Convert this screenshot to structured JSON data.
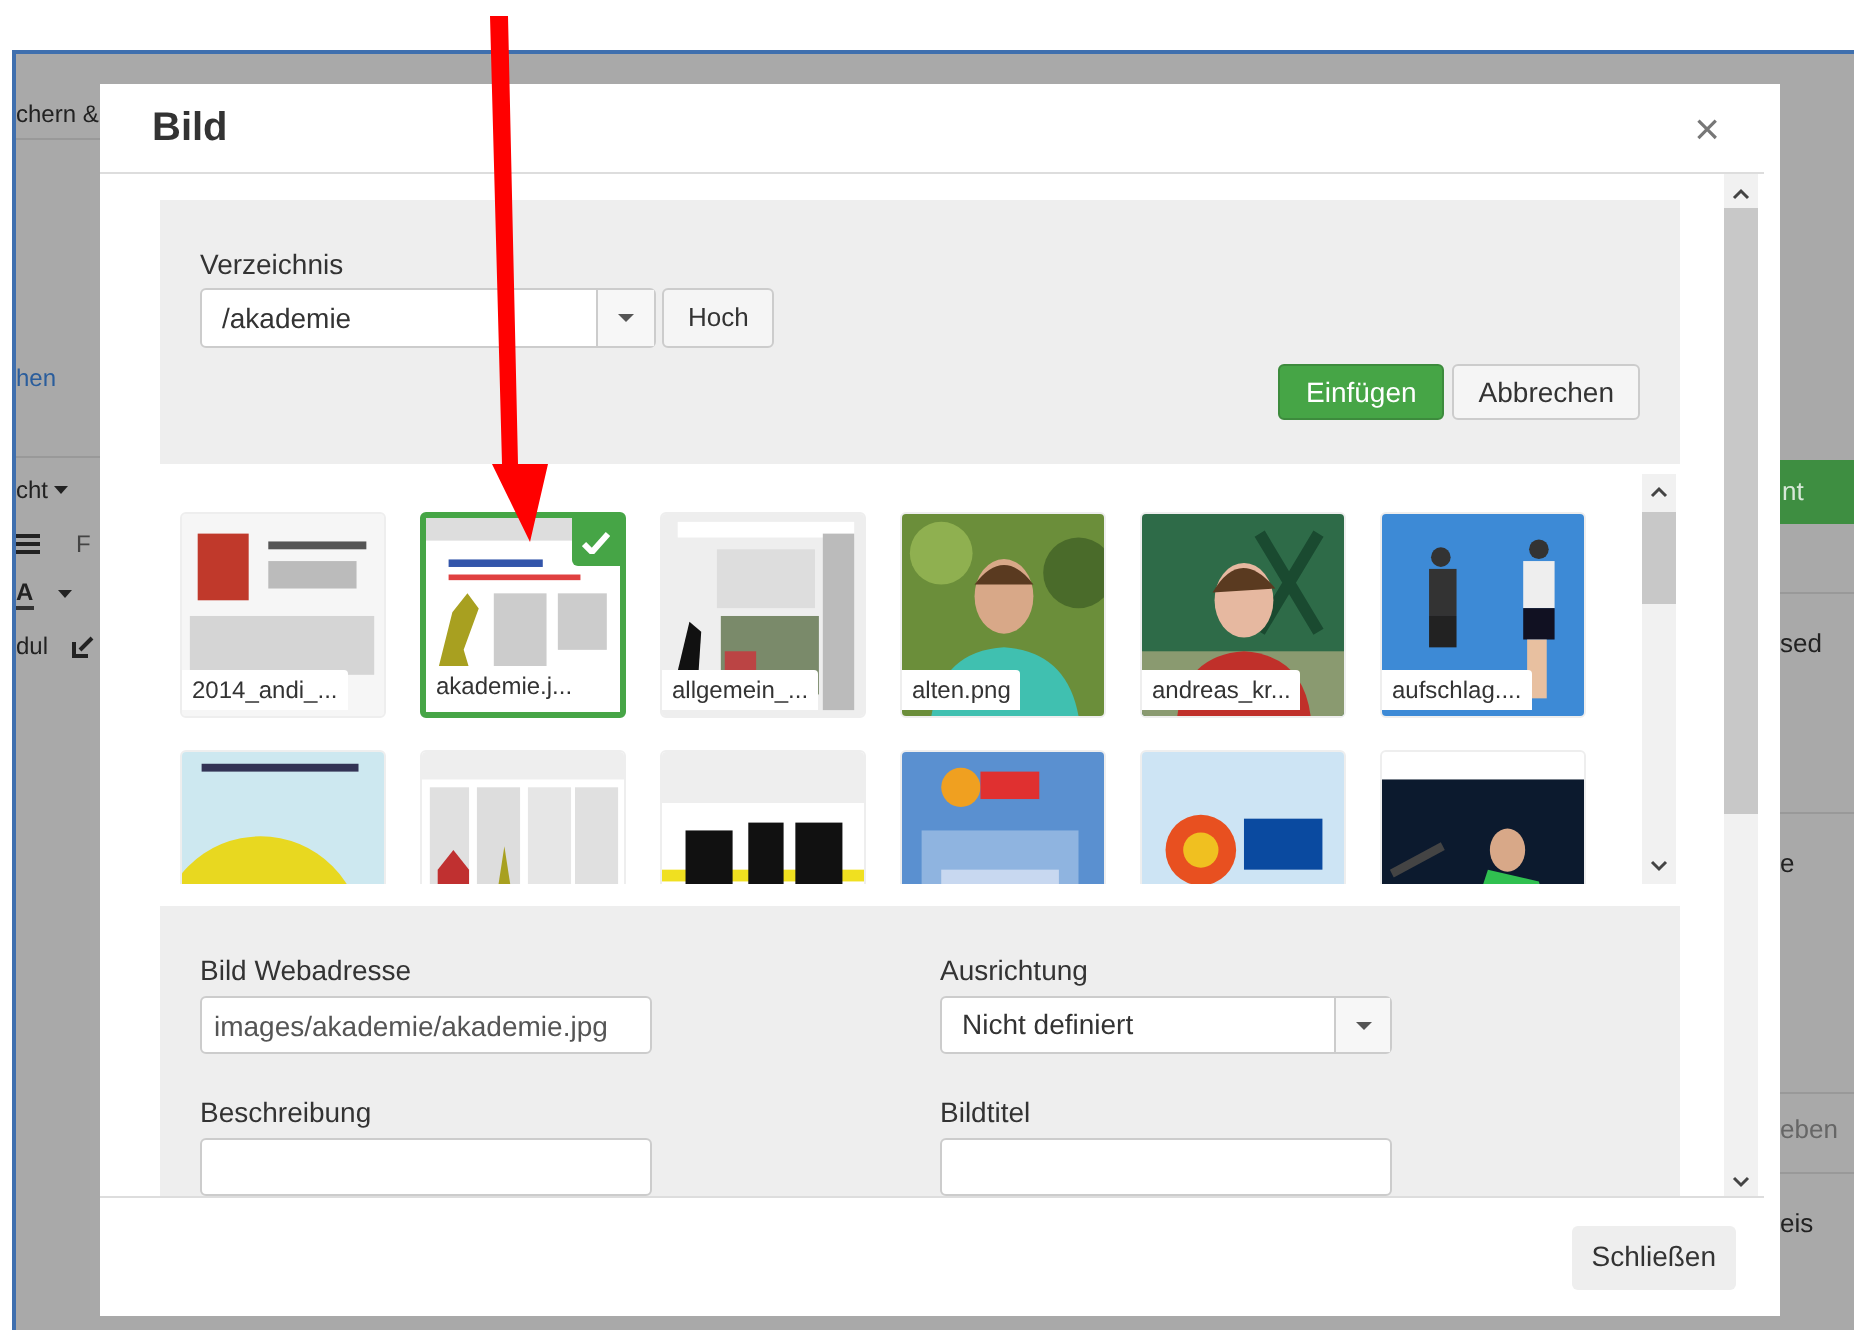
{
  "background_page": {
    "left_items": [
      {
        "kind": "text",
        "text": "chern &"
      },
      {
        "kind": "link",
        "text": "hen"
      },
      {
        "kind": "dropdown",
        "text": "cht"
      },
      {
        "kind": "toolbar",
        "text": "F"
      },
      {
        "kind": "color",
        "text": "A"
      },
      {
        "kind": "edit",
        "text": "dul"
      }
    ],
    "right_items": [
      {
        "kind": "button",
        "text": "nt"
      },
      {
        "kind": "text",
        "text": "sed"
      },
      {
        "kind": "text",
        "text": "e"
      },
      {
        "kind": "placeholder",
        "text": "eben"
      },
      {
        "kind": "text",
        "text": "eis"
      }
    ]
  },
  "dialog": {
    "title": "Bild",
    "close": "×",
    "directory": {
      "label": "Verzeichnis",
      "value": "/akademie",
      "up_button": "Hoch"
    },
    "actions": [
      "Einfügen",
      "Abbrechen"
    ],
    "thumbnails": [
      {
        "label": "2014_andi_...",
        "selected": false
      },
      {
        "label": "akademie.j...",
        "selected": true
      },
      {
        "label": "allgemein_...",
        "selected": false
      },
      {
        "label": "alten.png",
        "selected": false
      },
      {
        "label": "andreas_kr...",
        "selected": false
      },
      {
        "label": "aufschlag....",
        "selected": false
      },
      {
        "selected": false
      },
      {
        "selected": false
      },
      {
        "selected": false
      },
      {
        "selected": false
      },
      {
        "selected": false
      },
      {
        "selected": false
      }
    ],
    "fields": [
      {
        "label": "Bild Webadresse",
        "kind": "text",
        "value": "images/akademie/akademie.jpg"
      },
      {
        "label": "Ausrichtung",
        "kind": "select",
        "value": "Nicht definiert"
      },
      {
        "label": "Beschreibung",
        "kind": "text"
      },
      {
        "label": "Bildtitel",
        "kind": "text"
      }
    ],
    "footer_button": "Schließen"
  }
}
